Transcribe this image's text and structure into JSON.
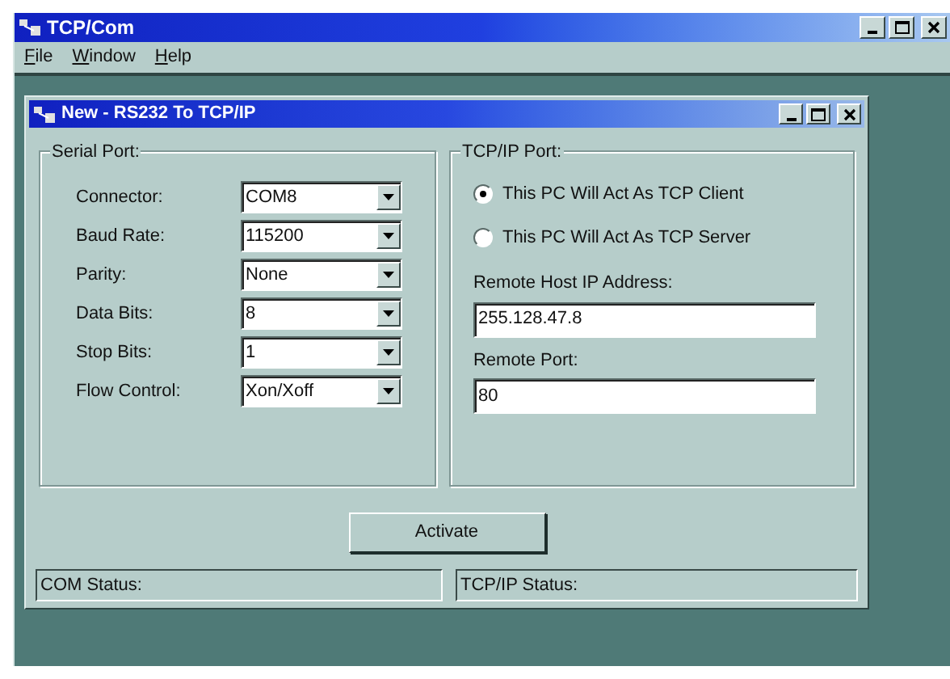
{
  "window": {
    "title": "TCP/Com"
  },
  "menu": [
    {
      "label": "File"
    },
    {
      "label": "Window"
    },
    {
      "label": "Help"
    }
  ],
  "child_window": {
    "title": "New - RS232 To TCP/IP",
    "serial_port": {
      "title": "Serial Port:",
      "fields": [
        {
          "label": "Connector:",
          "value": "COM8"
        },
        {
          "label": "Baud Rate:",
          "value": "115200"
        },
        {
          "label": "Parity:",
          "value": "None"
        },
        {
          "label": "Data Bits:",
          "value": "8"
        },
        {
          "label": "Stop Bits:",
          "value": "1"
        },
        {
          "label": "Flow Control:",
          "value": "Xon/Xoff"
        }
      ]
    },
    "tcp_ip_port": {
      "title": "TCP/IP Port:",
      "modes": [
        {
          "label": "This PC Will Act As TCP Client",
          "selected": true
        },
        {
          "label": "This PC Will Act As TCP Server",
          "selected": false
        }
      ],
      "fields": [
        {
          "label": "Remote Host IP Address:",
          "value": "255.128.47.8"
        },
        {
          "label": "Remote Port:",
          "value": "80"
        }
      ]
    },
    "activate_button": "Activate",
    "status_bar": [
      {
        "label": "COM Status:"
      },
      {
        "label": "TCP/IP Status:"
      }
    ]
  }
}
